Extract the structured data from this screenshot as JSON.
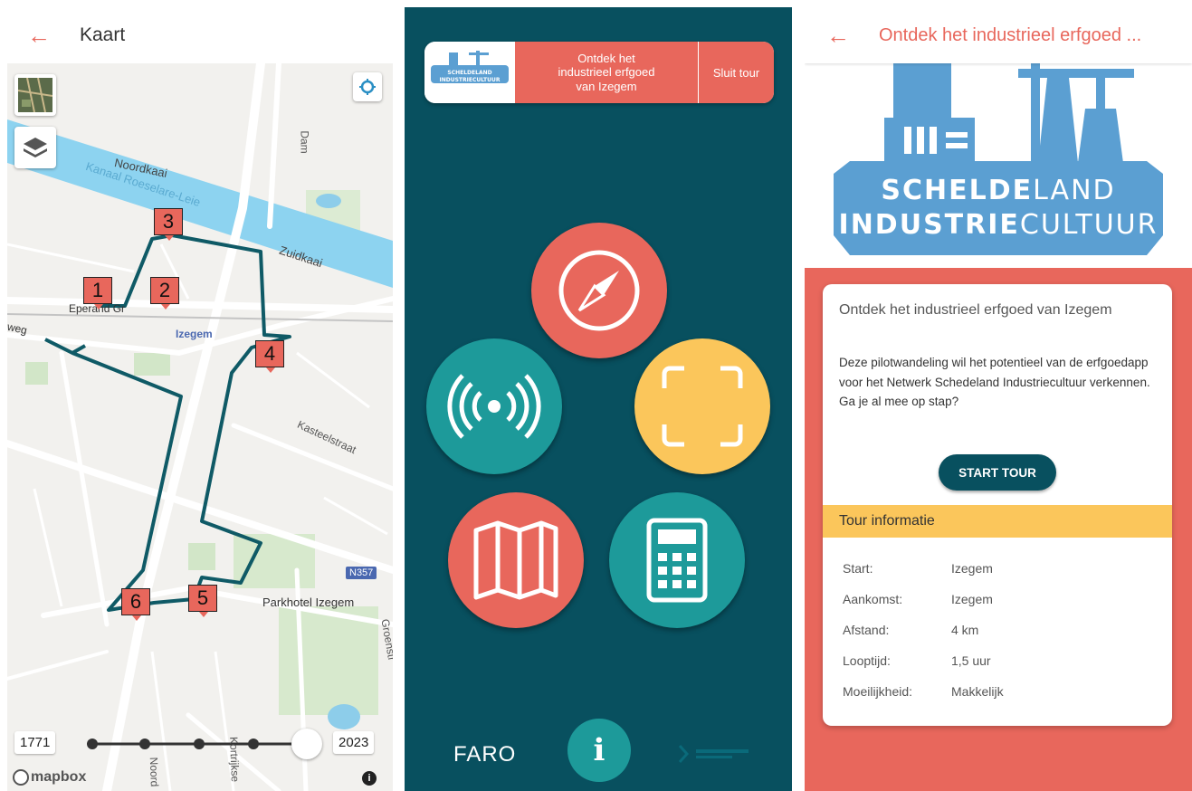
{
  "map_screen": {
    "back_icon": "arrow-left-icon",
    "title": "Kaart",
    "labels": {
      "noordkaai": "Noordkaai",
      "kanaal": "Kanaal Roeselare-Leie",
      "zuidkaai": "Zuidkaai",
      "dam": "Dam",
      "eperand": "Eperand Gr",
      "izegem": "Izegem",
      "weg": "weg",
      "kasteelstraat": "Kasteelstraat",
      "n357": "N357",
      "parkhotel": "Parkhotel Izegem",
      "groenstr": "Groenstr",
      "noord": "Noord",
      "kortrijkse": "Kortrijkse"
    },
    "markers": [
      "1",
      "2",
      "3",
      "4",
      "5",
      "6"
    ],
    "timeline": {
      "start_year": "1771",
      "end_year": "2023"
    },
    "attribution": "mapbox",
    "accent": "#e8675c",
    "route_color": "#0f5a66"
  },
  "menu_screen": {
    "tour_title": "Ontdek het\nindustrieel erfgoed\nvan Izegem",
    "close_label": "Sluit tour",
    "logo_top": "SCHELDELAND",
    "logo_bottom": "INDUSTRIECULTUUR",
    "buttons": [
      {
        "icon": "compass-icon",
        "color": "#e8675c"
      },
      {
        "icon": "beacon-icon",
        "color": "#1d9a9a"
      },
      {
        "icon": "scan-icon",
        "color": "#fbc65b"
      },
      {
        "icon": "map-icon",
        "color": "#e8675c"
      },
      {
        "icon": "calculator-icon",
        "color": "#1d9a9a"
      }
    ],
    "footer_brand": "FARO",
    "info_label": "i",
    "background": "#08505f"
  },
  "detail_screen": {
    "title": "Ontdek het industrieel erfgoed ...",
    "logo_line1_bold": "SCHELDE",
    "logo_line1_light": "LAND",
    "logo_line2_bold": "INDUSTRIE",
    "logo_line2_light": "CULTUUR",
    "card_title": "Ontdek het industrieel erfgoed van Izegem",
    "description": "Deze pilotwandeling wil het potentieel van de erfgoedapp voor het Netwerk Schedeland Industriecultuur verkennen. Ga je al mee op stap?",
    "start_button": "START TOUR",
    "info_heading": "Tour informatie",
    "info": [
      {
        "key": "Start:",
        "value": "Izegem"
      },
      {
        "key": "Aankomst:",
        "value": "Izegem"
      },
      {
        "key": "Afstand:",
        "value": "4 km"
      },
      {
        "key": "Looptijd:",
        "value": "1,5 uur"
      },
      {
        "key": "Moeilijkheid:",
        "value": "Makkelijk"
      }
    ]
  }
}
